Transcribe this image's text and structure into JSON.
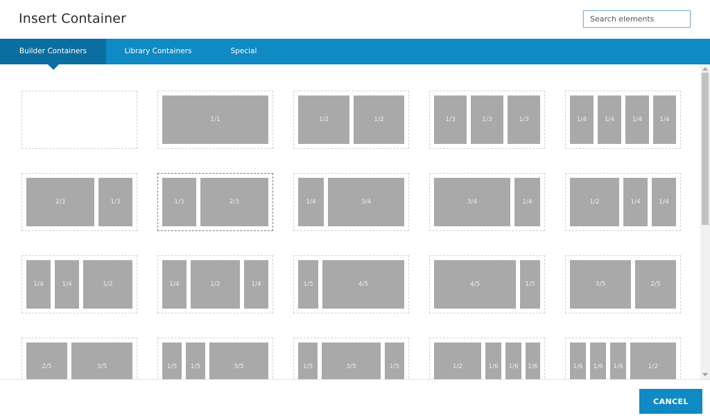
{
  "dialog": {
    "title": "Insert Container",
    "search": {
      "placeholder": "Search elements",
      "value": ""
    },
    "tabs": [
      {
        "label": "Builder Containers",
        "active": true
      },
      {
        "label": "Library Containers",
        "active": false
      },
      {
        "label": "Special",
        "active": false
      }
    ],
    "cancel_label": "CANCEL"
  },
  "colors": {
    "accent": "#0f8ac4",
    "tab_active": "#0b6ea0",
    "column_fill": "#a9a9a9"
  },
  "layouts": [
    {
      "name": "empty",
      "columns": []
    },
    {
      "name": "1-1",
      "columns": [
        "1/1"
      ]
    },
    {
      "name": "1-2_1-2",
      "columns": [
        "1/2",
        "1/2"
      ]
    },
    {
      "name": "1-3_1-3_1-3",
      "columns": [
        "1/3",
        "1/3",
        "1/3"
      ]
    },
    {
      "name": "1-4x4",
      "columns": [
        "1/4",
        "1/4",
        "1/4",
        "1/4"
      ]
    },
    {
      "name": "2-3_1-3",
      "columns": [
        "2/3",
        "1/3"
      ]
    },
    {
      "name": "1-3_2-3",
      "columns": [
        "1/3",
        "2/3"
      ],
      "selected": true
    },
    {
      "name": "1-4_3-4",
      "columns": [
        "1/4",
        "3/4"
      ]
    },
    {
      "name": "3-4_1-4",
      "columns": [
        "3/4",
        "1/4"
      ]
    },
    {
      "name": "1-2_1-4_1-4",
      "columns": [
        "1/2",
        "1/4",
        "1/4"
      ]
    },
    {
      "name": "1-4_1-4_1-2",
      "columns": [
        "1/4",
        "1/4",
        "1/2"
      ]
    },
    {
      "name": "1-4_1-2_1-4",
      "columns": [
        "1/4",
        "1/2",
        "1/4"
      ]
    },
    {
      "name": "1-5_4-5",
      "columns": [
        "1/5",
        "4/5"
      ]
    },
    {
      "name": "4-5_1-5",
      "columns": [
        "4/5",
        "1/5"
      ]
    },
    {
      "name": "3-5_2-5",
      "columns": [
        "3/5",
        "2/5"
      ]
    },
    {
      "name": "2-5_3-5",
      "columns": [
        "2/5",
        "3/5"
      ]
    },
    {
      "name": "1-5_1-5_3-5",
      "columns": [
        "1/5",
        "1/5",
        "3/5"
      ]
    },
    {
      "name": "1-5_3-5_1-5",
      "columns": [
        "1/5",
        "3/5",
        "1/5"
      ]
    },
    {
      "name": "1-2_1-6x3",
      "columns": [
        "1/2",
        "1/6",
        "1/6",
        "1/6"
      ]
    },
    {
      "name": "1-6x3_1-2",
      "columns": [
        "1/6",
        "1/6",
        "1/6",
        "1/2"
      ]
    }
  ]
}
